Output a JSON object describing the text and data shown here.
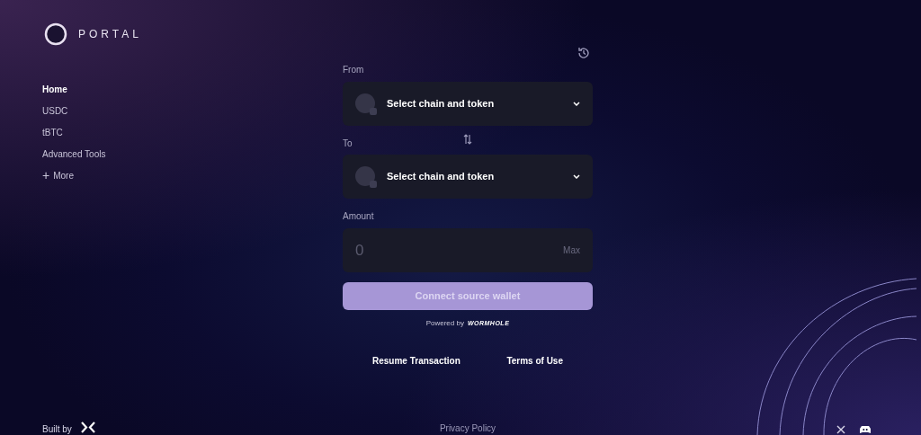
{
  "brand": {
    "name": "PORTAL"
  },
  "nav": [
    {
      "label": "Home",
      "selected": true
    },
    {
      "label": "USDC",
      "selected": false
    },
    {
      "label": "tBTC",
      "selected": false
    },
    {
      "label": "Advanced Tools",
      "selected": false
    },
    {
      "label": "More",
      "selected": false,
      "kind": "expand",
      "icon": "+"
    }
  ],
  "from": {
    "label": "From",
    "selector": "Select chain and token"
  },
  "to": {
    "label": "To",
    "selector": "Select chain and token"
  },
  "amount": {
    "label": "Amount",
    "placeholder": "0",
    "max": "Max"
  },
  "connect_button": {
    "label": "Connect source wallet",
    "disabled": true
  },
  "powered_by": {
    "text": "Powered by",
    "brand": "WORMHOLE"
  },
  "links": [
    "Resume Transaction",
    "Terms of Use"
  ],
  "footer": {
    "built_by": "Built by",
    "privacy": "Privacy Policy"
  }
}
